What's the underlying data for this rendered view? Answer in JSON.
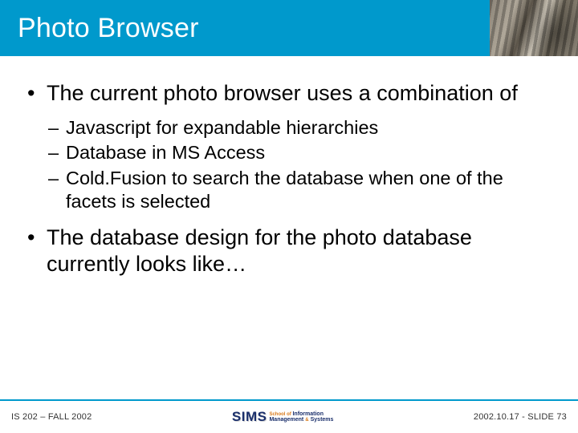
{
  "title": "Photo Browser",
  "bullets": {
    "b1": "The current photo browser uses a combination of",
    "b1_sub": {
      "s1": "Javascript for expandable hierarchies",
      "s2": "Database in MS Access",
      "s3": "Cold.Fusion to search the database when one of the facets is selected"
    },
    "b2": "The database design for the photo database currently looks like…"
  },
  "footer": {
    "left": "IS 202 – FALL 2002",
    "right": "2002.10.17 - SLIDE 73",
    "logo": {
      "mark": "SIMS",
      "line1": "School of",
      "line2a": "Information",
      "line2b": "Management",
      "amp": "&",
      "line2c": "Systems"
    }
  },
  "colors": {
    "accent": "#0099cc",
    "text": "#000000",
    "logo_blue": "#1a2f6b",
    "logo_orange": "#d97a1a"
  }
}
